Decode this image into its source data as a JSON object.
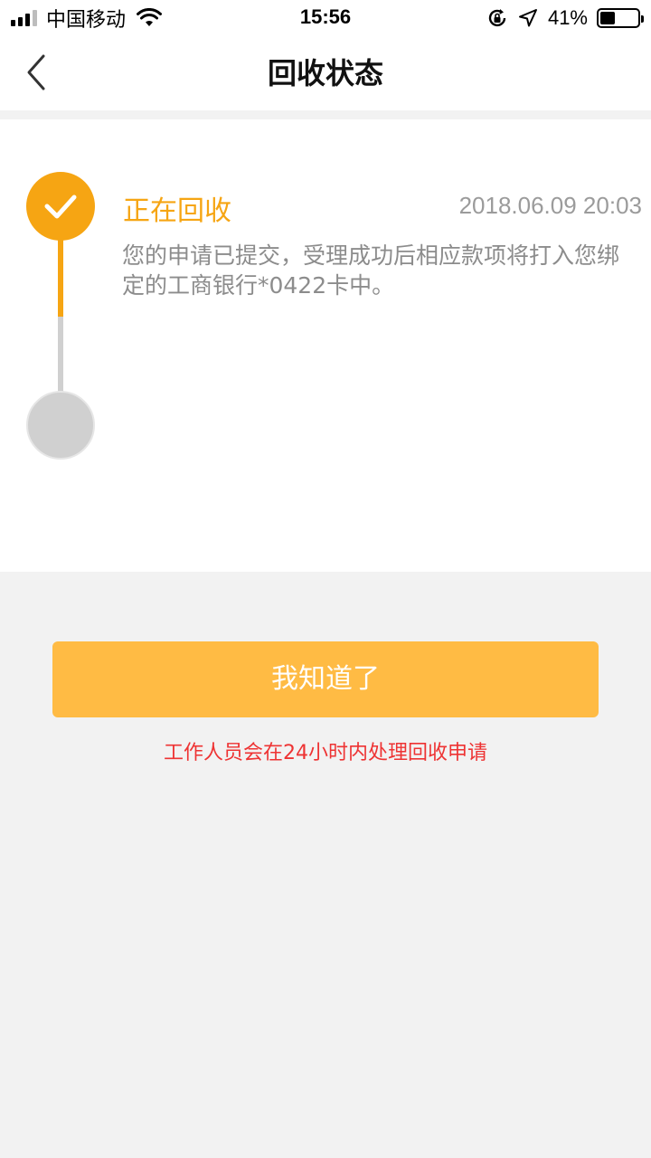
{
  "status_bar": {
    "carrier": "中国移动",
    "time": "15:56",
    "battery_percent": "41%",
    "battery_level": 0.41,
    "icons": [
      "signal-icon",
      "wifi-icon",
      "rotation-lock-icon",
      "location-arrow-icon",
      "battery-icon"
    ]
  },
  "nav": {
    "title": "回收状态",
    "back_icon": "chevron-left-icon"
  },
  "steps": [
    {
      "status": "done",
      "title": "正在回收",
      "time": "2018.06.09 20:03",
      "description": "您的申请已提交，受理成功后相应款项将打入您绑定的工商银行*0422卡中。",
      "icon": "check-icon"
    },
    {
      "status": "pending"
    }
  ],
  "actions": {
    "confirm_label": "我知道了"
  },
  "notice": "工作人员会在24小时内处理回收申请",
  "colors": {
    "accent": "#f6a513",
    "button": "#ffbb44",
    "notice": "#ee3333",
    "pending": "#d0d0d0",
    "background": "#f2f2f2"
  }
}
